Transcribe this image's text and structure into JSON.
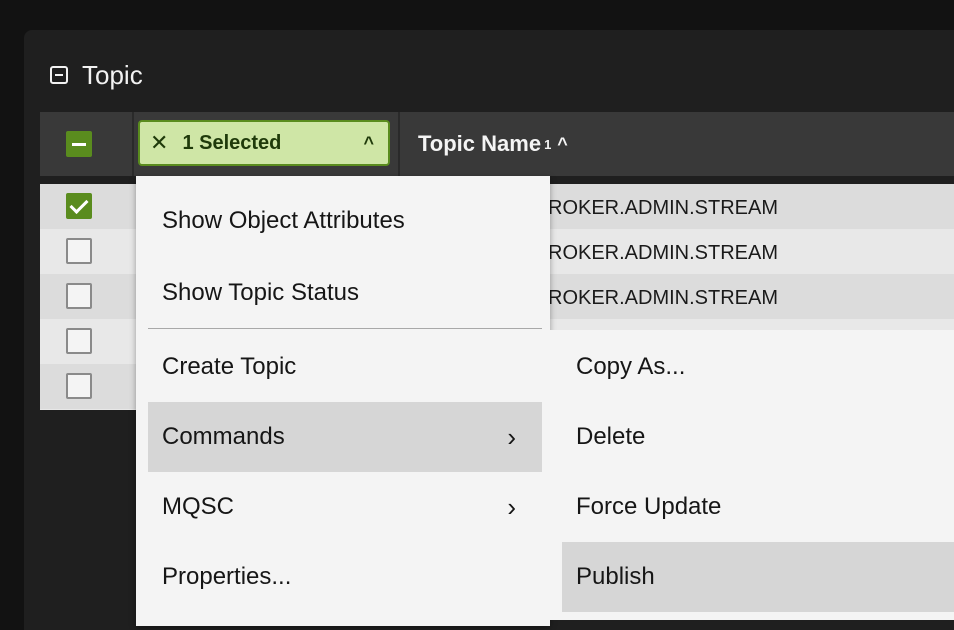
{
  "panel": {
    "title": "Topic"
  },
  "table": {
    "selection_label": "1 Selected",
    "column_title": "Topic Name",
    "sort_index": "1",
    "rows": [
      {
        "checked": true,
        "text": "ROKER.ADMIN.STREAM"
      },
      {
        "checked": false,
        "text": "ROKER.ADMIN.STREAM"
      },
      {
        "checked": false,
        "text": "ROKER.ADMIN.STREAM"
      },
      {
        "checked": false,
        "text": ""
      },
      {
        "checked": false,
        "text": ""
      }
    ]
  },
  "context_menu": {
    "items": [
      {
        "label": "Show Object Attributes"
      },
      {
        "label": "Show Topic Status"
      },
      {
        "label": "Create Topic"
      },
      {
        "label": "Commands",
        "submenu": true,
        "active": true
      },
      {
        "label": "MQSC",
        "submenu": true
      },
      {
        "label": "Properties..."
      }
    ]
  },
  "commands_submenu": {
    "items": [
      {
        "label": "Copy As..."
      },
      {
        "label": "Delete"
      },
      {
        "label": "Force Update"
      },
      {
        "label": "Publish",
        "active": true
      }
    ]
  },
  "icons": {
    "collapse": "collapse-square-icon",
    "clear_selection": "close-icon",
    "chip_caret": "chevron-up-icon",
    "sort": "sort-ascending-icon",
    "submenu": "chevron-right-icon"
  },
  "colors": {
    "accent_green": "#5a8c1e",
    "chip_bg": "#cfe6a6",
    "menu_active": "#d6d6d6"
  }
}
